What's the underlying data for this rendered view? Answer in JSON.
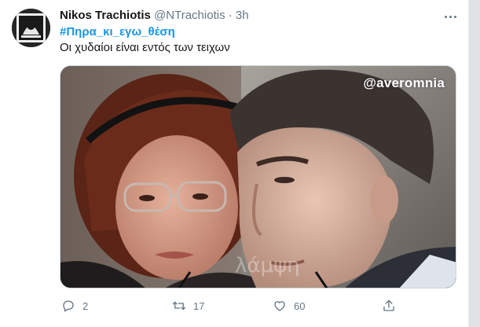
{
  "tweet": {
    "display_name": "Nikos Trachiotis",
    "handle": "@NTrachiotis",
    "separator": "·",
    "time": "3h",
    "hashtag": "#Πηρα_κι_εγω_θέση",
    "text": "Οι χυδαίοι είναι εντός των τειχων",
    "media": {
      "watermark": "@averomnia",
      "faint_watermark": "λάμψη"
    },
    "actions": {
      "reply_count": "2",
      "retweet_count": "17",
      "like_count": "60"
    },
    "icons": [
      "more-icon",
      "reply-icon",
      "retweet-icon",
      "like-icon",
      "share-icon"
    ]
  }
}
